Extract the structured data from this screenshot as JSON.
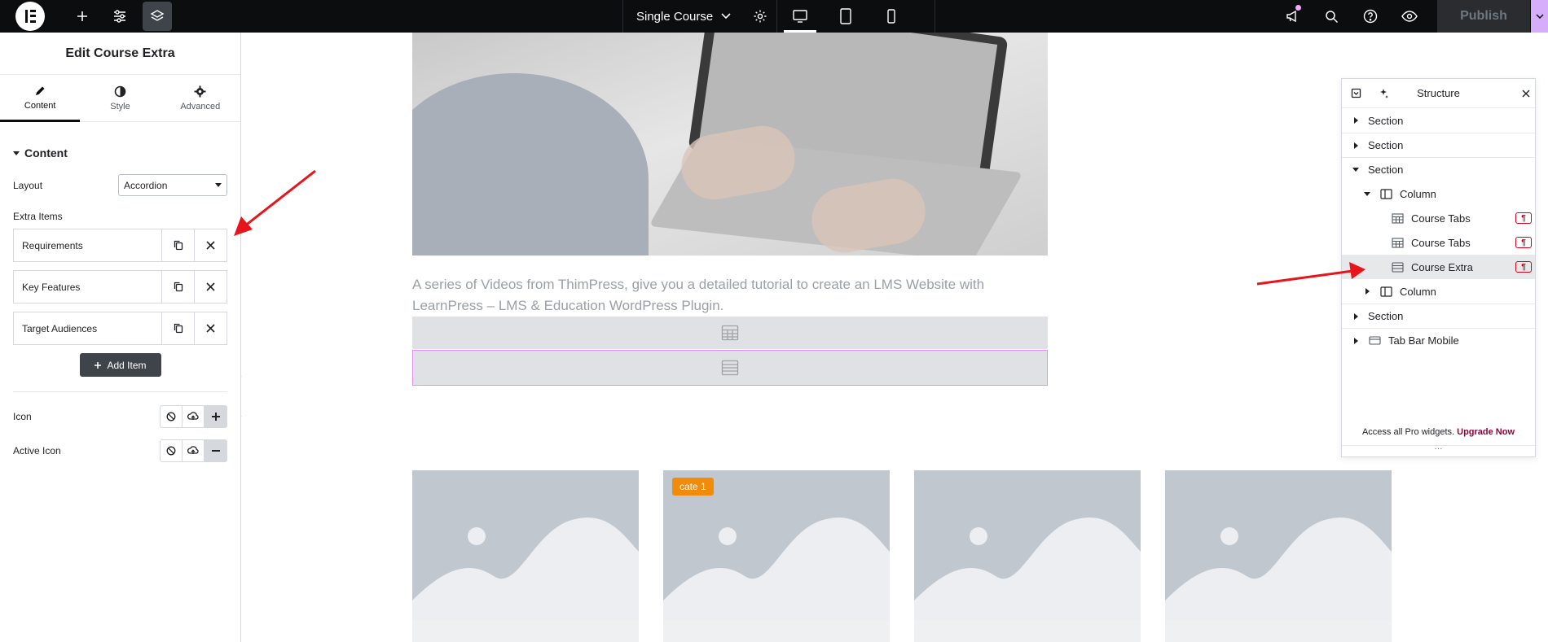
{
  "topbar": {
    "document_title": "Single Course",
    "publish_label": "Publish"
  },
  "panel": {
    "header_title": "Edit Course Extra",
    "tabs": [
      {
        "label": "Content",
        "icon": "pencil-icon",
        "active": true
      },
      {
        "label": "Style",
        "icon": "half-circle-icon",
        "active": false
      },
      {
        "label": "Advanced",
        "icon": "gear-icon",
        "active": false
      }
    ],
    "section_title": "Content",
    "layout_label": "Layout",
    "layout_value": "Accordion",
    "extra_items_label": "Extra Items",
    "items": [
      "Requirements",
      "Key Features",
      "Target Audiences"
    ],
    "add_item_label": "Add Item",
    "icon_label": "Icon",
    "active_icon_label": "Active Icon"
  },
  "canvas": {
    "description": "A series of Videos from ThimPress, give you a detailed tutorial to create an LMS Website with LearnPress – LMS & Education WordPress Plugin.",
    "card_badge": "cate 1"
  },
  "structure": {
    "title": "Structure",
    "nodes": [
      {
        "label": "Section"
      },
      {
        "label": "Section"
      },
      {
        "label": "Section"
      },
      {
        "label": "Column"
      },
      {
        "label": "Course Tabs"
      },
      {
        "label": "Course Tabs"
      },
      {
        "label": "Course Extra",
        "selected": true
      },
      {
        "label": "Column"
      },
      {
        "label": "Section"
      },
      {
        "label": "Tab Bar Mobile"
      }
    ],
    "footer_text": "Access all Pro widgets.",
    "footer_link": "Upgrade Now"
  },
  "colors": {
    "topbar_bg": "#0c0d0e",
    "publish_accent": "#d5adfb",
    "badge": "#f08b0c",
    "pro_flag": "#d0021b",
    "upgrade_link": "#93003c",
    "annotation_arrow": "#e8141b"
  }
}
